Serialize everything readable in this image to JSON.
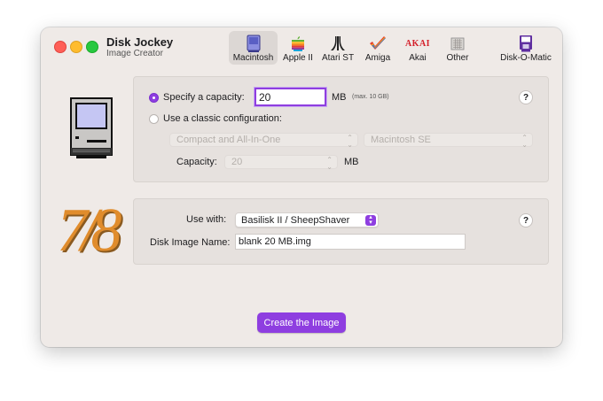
{
  "app": {
    "title": "Disk Jockey",
    "subtitle": "Image Creator"
  },
  "tabs": [
    {
      "label": "Macintosh",
      "icon": "macintosh-icon",
      "selected": true
    },
    {
      "label": "Apple II",
      "icon": "apple-logo-icon"
    },
    {
      "label": "Atari ST",
      "icon": "atari-logo-icon"
    },
    {
      "label": "Amiga",
      "icon": "amiga-checkmark-icon"
    },
    {
      "label": "Akai",
      "icon": "akai-logo-icon",
      "icon_text": "AKAI"
    },
    {
      "label": "Other",
      "icon": "generic-disk-icon"
    },
    {
      "label": "Disk-O-Matic",
      "icon": "disk-o-matic-icon"
    }
  ],
  "capacity_panel": {
    "specify_label": "Specify a capacity:",
    "capacity_value": "20",
    "unit": "MB",
    "max_note": "(max. 10 GB)",
    "classic_label": "Use a classic configuration:",
    "category_placeholder": "Compact and All-In-One",
    "model_placeholder": "Macintosh SE",
    "capacity_label": "Capacity:",
    "capacity_select": "20",
    "capacity_unit": "MB",
    "help": "?"
  },
  "emulator_panel": {
    "use_with_label": "Use with:",
    "use_with_value": "Basilisk II / SheepShaver",
    "disk_name_label": "Disk Image Name:",
    "disk_name_value": "blank 20 MB.img",
    "help": "?",
    "logo_text": "7/8"
  },
  "create_button": "Create the Image",
  "colors": {
    "accent": "#8e3ee0",
    "window_bg": "#efeae7",
    "panel_bg": "#e6e1de"
  }
}
